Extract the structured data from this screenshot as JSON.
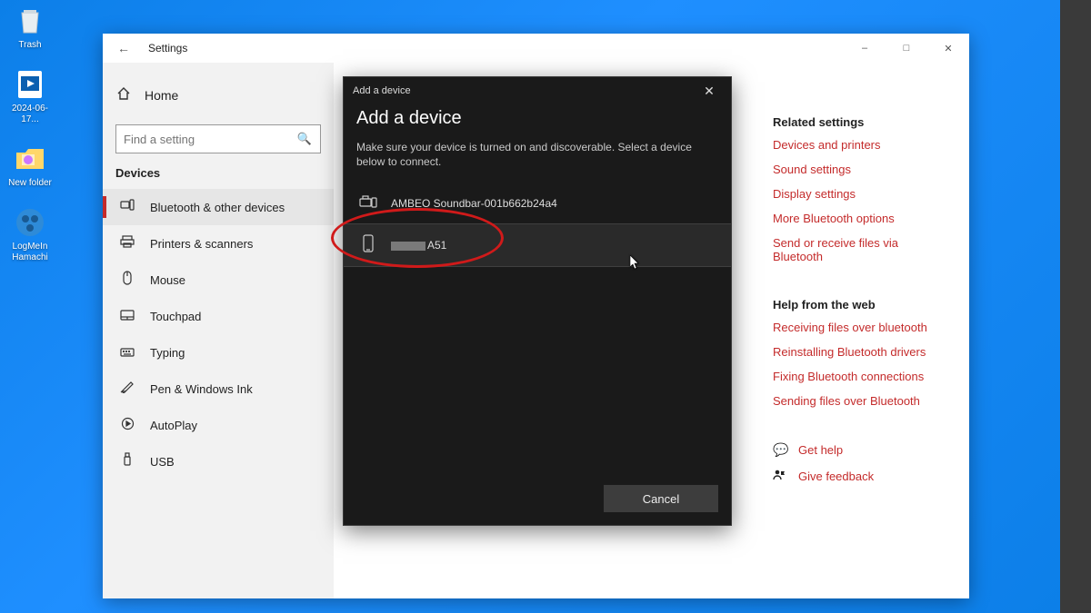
{
  "desktop": {
    "icons": [
      {
        "label": "Trash"
      },
      {
        "label": "2024-06-17..."
      },
      {
        "label": "New folder"
      },
      {
        "label": "LogMeIn Hamachi"
      }
    ]
  },
  "settings": {
    "window_title": "Settings",
    "home_label": "Home",
    "search_placeholder": "Find a setting",
    "section_header": "Devices",
    "nav": [
      {
        "label": "Bluetooth & other devices"
      },
      {
        "label": "Printers & scanners"
      },
      {
        "label": "Mouse"
      },
      {
        "label": "Touchpad"
      },
      {
        "label": "Typing"
      },
      {
        "label": "Pen & Windows Ink"
      },
      {
        "label": "AutoPlay"
      },
      {
        "label": "USB"
      }
    ],
    "related_heading": "Related settings",
    "related_links": [
      "Devices and printers",
      "Sound settings",
      "Display settings",
      "More Bluetooth options",
      "Send or receive files via Bluetooth"
    ],
    "help_heading": "Help from the web",
    "help_links": [
      "Receiving files over bluetooth",
      "Reinstalling Bluetooth drivers",
      "Fixing Bluetooth connections",
      "Sending files over Bluetooth"
    ],
    "get_help": "Get help",
    "give_feedback": "Give feedback"
  },
  "modal": {
    "titlebar": "Add a device",
    "heading": "Add a device",
    "subtext": "Make sure your device is turned on and discoverable. Select a device below to connect.",
    "devices": [
      {
        "label": "AMBEO Soundbar-001b662b24a4"
      },
      {
        "label": "A51"
      }
    ],
    "cancel": "Cancel"
  }
}
